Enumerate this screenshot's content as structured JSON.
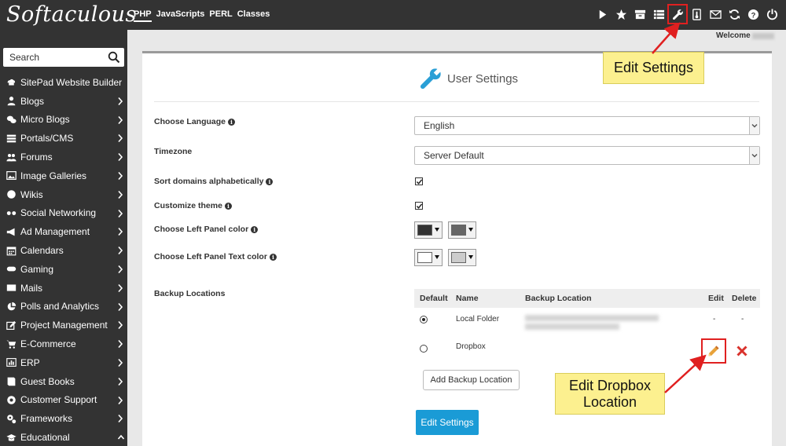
{
  "app": {
    "logo_text": "Softaculous"
  },
  "top_nav": {
    "tabs": [
      {
        "label": "PHP",
        "active": true
      },
      {
        "label": "JavaScripts",
        "active": false
      },
      {
        "label": "PERL",
        "active": false
      },
      {
        "label": "Classes",
        "active": false
      }
    ],
    "icons": [
      "play-icon",
      "star-icon",
      "archive-icon",
      "list-icon",
      "wrench-icon",
      "thermometer-icon",
      "mail-icon",
      "refresh-icon",
      "help-icon",
      "logout-icon"
    ],
    "highlighted_icon": "wrench-icon",
    "welcome_label": "Welcome"
  },
  "sidebar": {
    "search_placeholder": "Search",
    "items": [
      {
        "label": "SitePad Website Builder",
        "icon": "sitepad-icon",
        "has_children": false
      },
      {
        "label": "Blogs",
        "icon": "user-icon",
        "has_children": true
      },
      {
        "label": "Micro Blogs",
        "icon": "comments-icon",
        "has_children": true
      },
      {
        "label": "Portals/CMS",
        "icon": "list-icon",
        "has_children": true
      },
      {
        "label": "Forums",
        "icon": "users-icon",
        "has_children": true
      },
      {
        "label": "Image Galleries",
        "icon": "image-icon",
        "has_children": true
      },
      {
        "label": "Wikis",
        "icon": "globe-icon",
        "has_children": true
      },
      {
        "label": "Social Networking",
        "icon": "social-icon",
        "has_children": true
      },
      {
        "label": "Ad Management",
        "icon": "bullhorn-icon",
        "has_children": true
      },
      {
        "label": "Calendars",
        "icon": "calendar-icon",
        "has_children": true
      },
      {
        "label": "Gaming",
        "icon": "gamepad-icon",
        "has_children": true
      },
      {
        "label": "Mails",
        "icon": "envelope-icon",
        "has_children": true
      },
      {
        "label": "Polls and Analytics",
        "icon": "pie-chart-icon",
        "has_children": true
      },
      {
        "label": "Project Management",
        "icon": "edit-icon",
        "has_children": true
      },
      {
        "label": "E-Commerce",
        "icon": "cart-icon",
        "has_children": true
      },
      {
        "label": "ERP",
        "icon": "chart-icon",
        "has_children": true
      },
      {
        "label": "Guest Books",
        "icon": "book-icon",
        "has_children": true
      },
      {
        "label": "Customer Support",
        "icon": "support-icon",
        "has_children": true
      },
      {
        "label": "Frameworks",
        "icon": "cogs-icon",
        "has_children": true
      },
      {
        "label": "Educational",
        "icon": "graduation-cap-icon",
        "has_children": true,
        "expanded": true
      }
    ]
  },
  "panel": {
    "title": "User Settings",
    "title_icon": "wrench-icon",
    "fields": {
      "language": {
        "label": "Choose Language",
        "value": "English"
      },
      "timezone": {
        "label": "Timezone",
        "value": "Server Default"
      },
      "sort_domains": {
        "label": "Sort domains alphabetically",
        "checked": true
      },
      "customize_theme": {
        "label": "Customize theme",
        "checked": true
      },
      "left_panel_color": {
        "label": "Choose Left Panel color",
        "swatches": [
          "#333333",
          "#666666"
        ]
      },
      "left_panel_text_color": {
        "label": "Choose Left Panel Text color",
        "swatches": [
          "#ffffff",
          "#cccccc"
        ]
      }
    },
    "backup": {
      "label": "Backup Locations",
      "columns": [
        "Default",
        "Name",
        "Backup Location",
        "Edit",
        "Delete"
      ],
      "rows": [
        {
          "default": true,
          "name": "Local Folder",
          "location_redacted": true,
          "edit": "-",
          "delete": "-"
        },
        {
          "default": false,
          "name": "Dropbox",
          "location_redacted": false,
          "edit": "pencil-icon",
          "delete": "x-icon"
        }
      ],
      "add_button": "Add Backup Location"
    },
    "submit_button": "Edit Settings"
  },
  "callouts": {
    "edit_settings": "Edit Settings",
    "edit_dropbox": "Edit Dropbox Location"
  },
  "colors": {
    "topbar_bg": "#333333",
    "accent": "#1a9bd6",
    "callout_bg": "#fcf08f",
    "highlight_red": "#e02020",
    "delete_red": "#d9322c",
    "pencil_orange": "#e8a23a"
  }
}
